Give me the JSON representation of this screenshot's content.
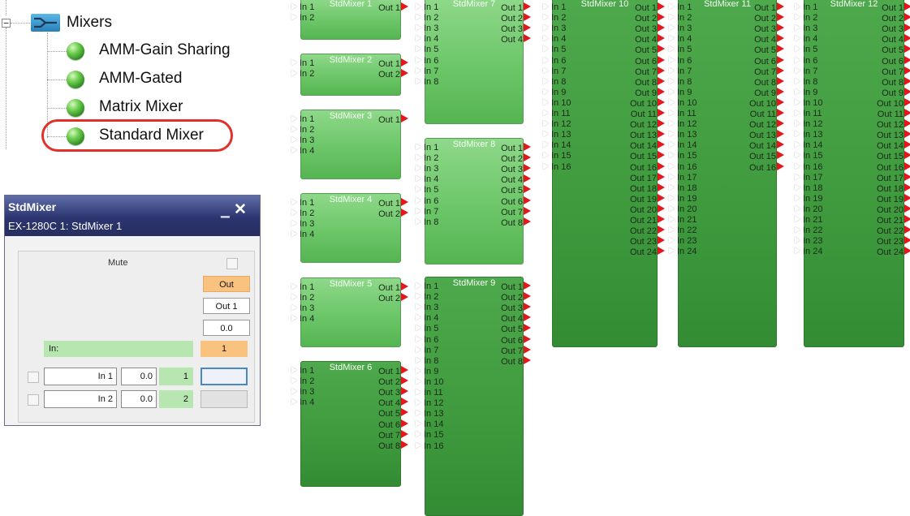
{
  "tree": {
    "root_label": "Mixers",
    "expander": "−",
    "items": [
      {
        "label": "AMM-Gain Sharing"
      },
      {
        "label": "AMM-Gated"
      },
      {
        "label": "Matrix Mixer"
      },
      {
        "label": "Standard Mixer"
      }
    ]
  },
  "control": {
    "title": "StdMixer",
    "subtitle": "EX-1280C 1: StdMixer 1",
    "mute_label": "Mute",
    "out_header": "Out",
    "out_name": "Out 1",
    "out_gain": "0.0",
    "in_label": "In:",
    "in_col": "1",
    "inputs": [
      {
        "name": "In 1",
        "gain": "0.0",
        "num": "1"
      },
      {
        "name": "In 2",
        "gain": "0.0",
        "num": "2"
      }
    ]
  },
  "mixers": [
    {
      "title": "StdMixer 1",
      "inputs": 2,
      "outputs": 1
    },
    {
      "title": "StdMixer 2",
      "inputs": 2,
      "outputs": 2
    },
    {
      "title": "StdMixer 3",
      "inputs": 4,
      "outputs": 1
    },
    {
      "title": "StdMixer 4",
      "inputs": 4,
      "outputs": 2
    },
    {
      "title": "StdMixer 5",
      "inputs": 4,
      "outputs": 2
    },
    {
      "title": "StdMixer 6",
      "inputs": 4,
      "outputs": 8
    },
    {
      "title": "StdMixer 7",
      "inputs": 8,
      "outputs": 4
    },
    {
      "title": "StdMixer 8",
      "inputs": 8,
      "outputs": 8
    },
    {
      "title": "StdMixer 9",
      "inputs": 16,
      "outputs": 8
    },
    {
      "title": "StdMixer 10",
      "inputs": 16,
      "outputs": 24
    },
    {
      "title": "StdMixer 11",
      "inputs": 24,
      "outputs": 16
    },
    {
      "title": "StdMixer 12",
      "inputs": 24,
      "outputs": 24
    }
  ],
  "pin_labels": {
    "in_prefix": "In",
    "out_prefix": "Out"
  },
  "colors": {
    "output_pin": "#e3171c",
    "highlight_ring": "#e0322a",
    "block_green": "#6cc668"
  }
}
